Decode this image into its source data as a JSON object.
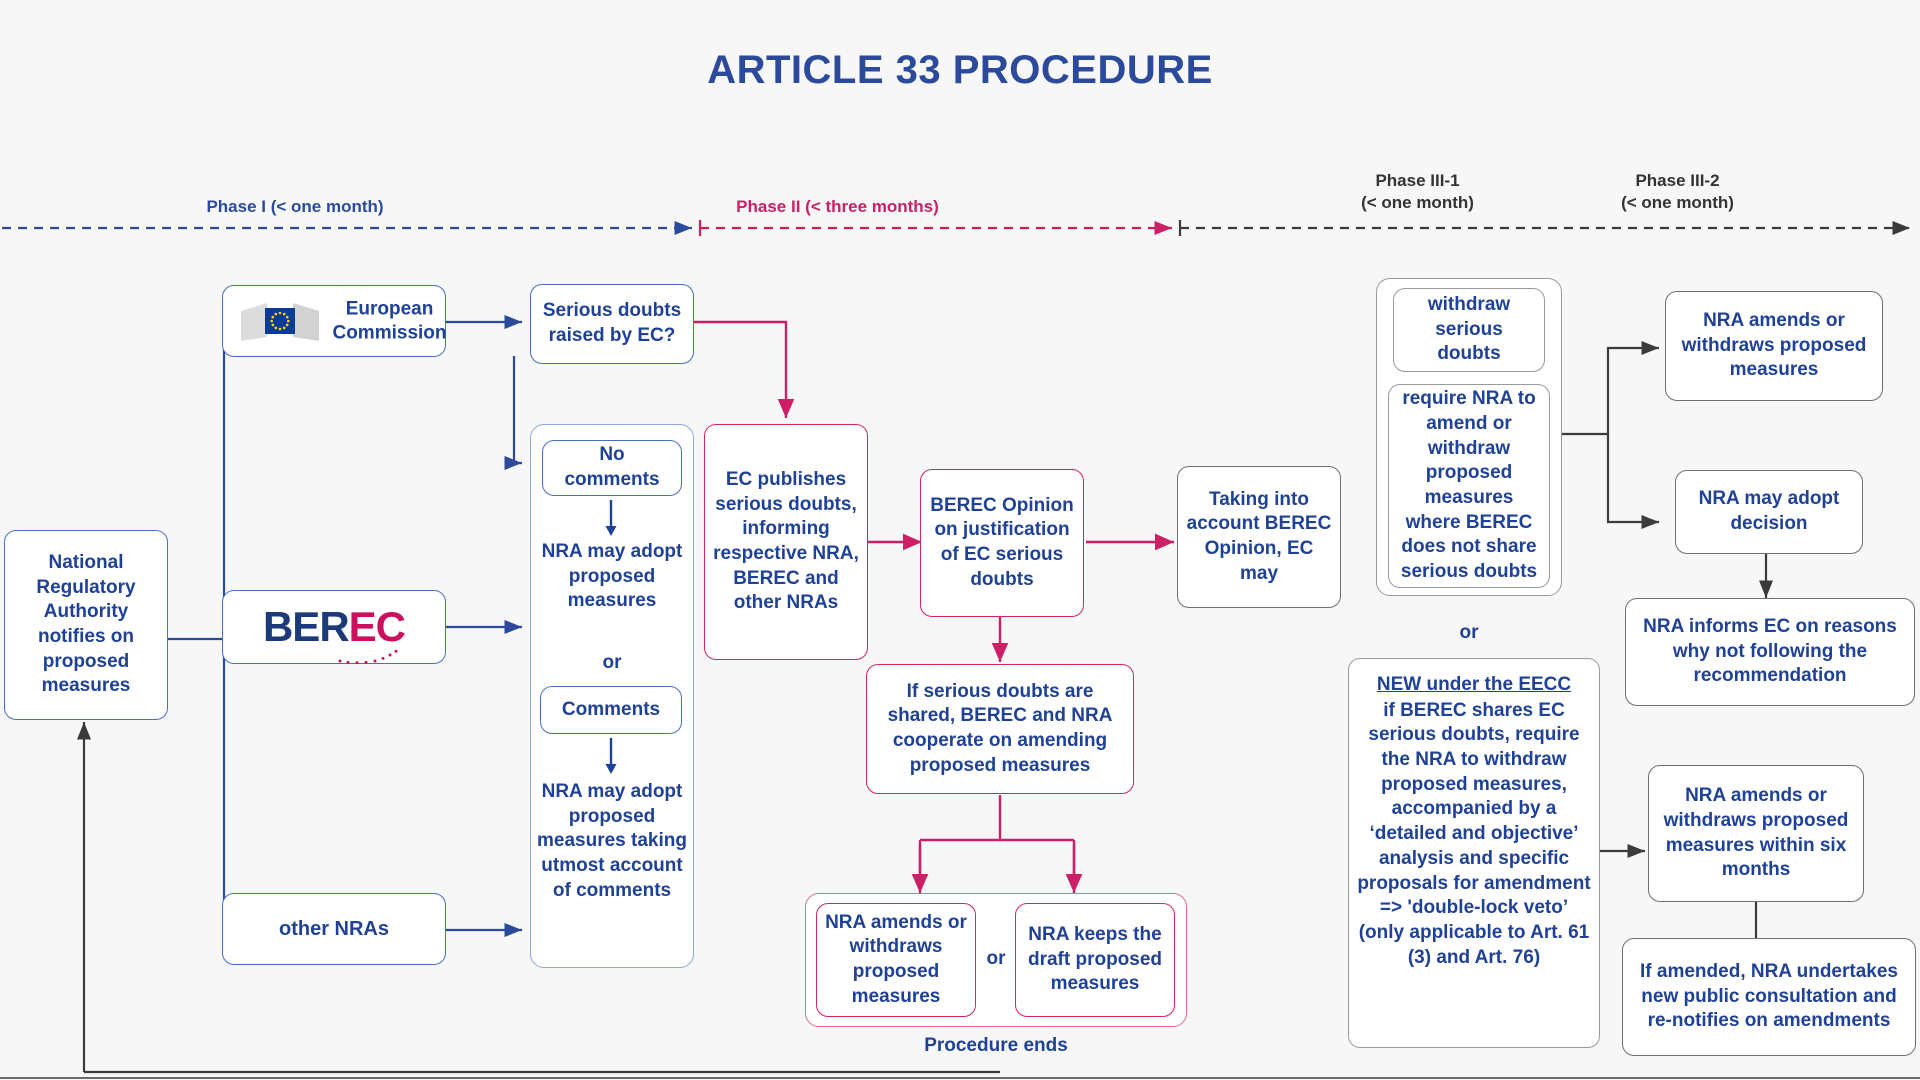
{
  "title": "ARTICLE 33 PROCEDURE",
  "colors": {
    "title_blue": "#2b4a9b",
    "node_text": "#1f4196",
    "phase1": "#2b4a9b",
    "phase2": "#cc1f66",
    "phase3": "#333333",
    "pink_border": "#d1246b",
    "blue_border": "#4a6fbf",
    "gray_border": "#6f6f6f",
    "background": "#f7f7f7"
  },
  "phases": [
    {
      "name": "Phase I",
      "duration": "(< one month)",
      "label": "Phase I (< one month)",
      "color": "#2b4a9b"
    },
    {
      "name": "Phase II",
      "duration": "(< three months)",
      "label": "Phase II (< three months)",
      "color": "#cc1f66"
    },
    {
      "name": "Phase III-1",
      "duration": "(< one month)",
      "color": "#333333"
    },
    {
      "name": "Phase III-2",
      "duration": "(< one month)",
      "color": "#333333"
    }
  ],
  "nodes": {
    "nra_notifies": "National Regulatory Authority notifies on proposed measures",
    "european_commission": "European Commission",
    "berec_logo": {
      "part1": "BER",
      "part2": "EC"
    },
    "other_nras": "other NRAs",
    "serious_doubts_q": "Serious doubts raised by EC?",
    "no_comments": "No comments",
    "nra_may_adopt": "NRA may adopt proposed measures",
    "or_mid": "or",
    "comments": "Comments",
    "nra_may_adopt_utmost": "NRA may adopt proposed measures taking utmost account of comments",
    "ec_publishes": "EC publishes serious doubts, informing respective NRA, BEREC and other NRAs",
    "berec_opinion": "BEREC Opinion on justification of EC serious doubts",
    "taking_into_account": "Taking into account BEREC Opinion, EC may",
    "if_serious_doubts_shared": "If serious doubts are shared, BEREC and NRA cooperate on amending proposed measures",
    "nra_amends_withdraws": "NRA amends or withdraws proposed measures",
    "or_bottom": "or",
    "nra_keeps_draft": "NRA keeps the draft proposed measures",
    "procedure_ends": "Procedure ends",
    "withdraw_serious_doubts": "withdraw serious doubts",
    "require_nra_amend": "require NRA to amend or withdraw proposed measures where BEREC does not share serious doubts",
    "or_phase3": "or",
    "new_eecc_heading": "NEW under the EECC",
    "new_eecc_body": "if BEREC shares EC serious doubts, require the NRA to withdraw proposed measures, accompanied by a ‘detailed and objective’ analysis and specific proposals for amendment => 'double-lock veto’ (only applicable to Art. 61 (3) and Art. 76)",
    "nra_amends_withdraws_right": "NRA amends or withdraws proposed measures",
    "nra_may_adopt_decision": "NRA may adopt decision",
    "nra_informs_ec": "NRA informs EC on reasons why not following the recommendation",
    "nra_amends_six_months": "NRA amends or withdraws proposed measures within six months",
    "if_amended_new_consultation": "If amended, NRA undertakes new public consultation and re-notifies on amendments"
  }
}
